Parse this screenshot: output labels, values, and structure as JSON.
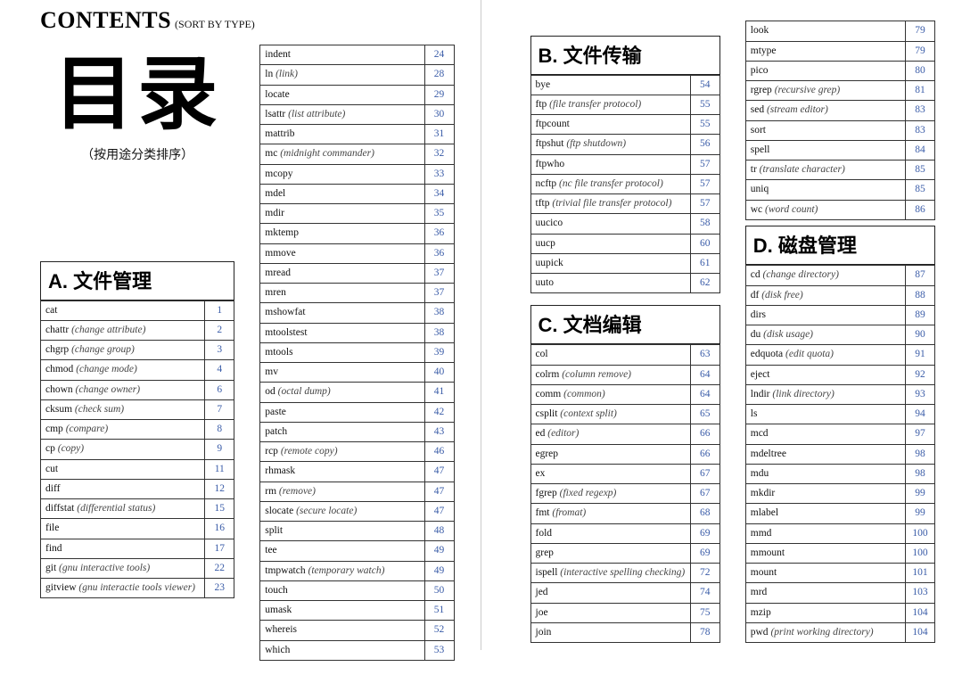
{
  "header": {
    "title": "CONTENTS",
    "sub": "(SORT BY TYPE)",
    "big_cjk": "目录",
    "sub_cjk": "（按用途分类排序）"
  },
  "sections": {
    "A": {
      "label": "A. 文件管理"
    },
    "B": {
      "label": "B. 文件传输"
    },
    "C": {
      "label": "C. 文档编辑"
    },
    "D": {
      "label": "D. 磁盘管理"
    }
  },
  "tables": {
    "A1": [
      {
        "cmd": "cat",
        "note": "",
        "pg": "1"
      },
      {
        "cmd": "chattr",
        "note": "(change attribute)",
        "pg": "2"
      },
      {
        "cmd": "chgrp",
        "note": "(change group)",
        "pg": "3"
      },
      {
        "cmd": "chmod",
        "note": "(change mode)",
        "pg": "4"
      },
      {
        "cmd": "chown",
        "note": "(change owner)",
        "pg": "6"
      },
      {
        "cmd": "cksum",
        "note": "(check sum)",
        "pg": "7"
      },
      {
        "cmd": "cmp",
        "note": "(compare)",
        "pg": "8"
      },
      {
        "cmd": "cp",
        "note": "(copy)",
        "pg": "9"
      },
      {
        "cmd": "cut",
        "note": "",
        "pg": "11"
      },
      {
        "cmd": "diff",
        "note": "",
        "pg": "12"
      },
      {
        "cmd": "diffstat",
        "note": "(differential status)",
        "pg": "15"
      },
      {
        "cmd": "file",
        "note": "",
        "pg": "16"
      },
      {
        "cmd": "find",
        "note": "",
        "pg": "17"
      },
      {
        "cmd": "git",
        "note": "(gnu interactive tools)",
        "pg": "22"
      },
      {
        "cmd": "gitview",
        "note": "(gnu interactie tools viewer)",
        "pg": "23"
      }
    ],
    "A2": [
      {
        "cmd": "indent",
        "note": "",
        "pg": "24"
      },
      {
        "cmd": "ln",
        "note": "(link)",
        "pg": "28"
      },
      {
        "cmd": "locate",
        "note": "",
        "pg": "29"
      },
      {
        "cmd": "lsattr",
        "note": "(list attribute)",
        "pg": "30"
      },
      {
        "cmd": "mattrib",
        "note": "",
        "pg": "31"
      },
      {
        "cmd": "mc",
        "note": "(midnight commander)",
        "pg": "32"
      },
      {
        "cmd": "mcopy",
        "note": "",
        "pg": "33"
      },
      {
        "cmd": "mdel",
        "note": "",
        "pg": "34"
      },
      {
        "cmd": "mdir",
        "note": "",
        "pg": "35"
      },
      {
        "cmd": "mktemp",
        "note": "",
        "pg": "36"
      },
      {
        "cmd": "mmove",
        "note": "",
        "pg": "36"
      },
      {
        "cmd": "mread",
        "note": "",
        "pg": "37"
      },
      {
        "cmd": "mren",
        "note": "",
        "pg": "37"
      },
      {
        "cmd": "mshowfat",
        "note": "",
        "pg": "38"
      },
      {
        "cmd": "mtoolstest",
        "note": "",
        "pg": "38"
      },
      {
        "cmd": "mtools",
        "note": "",
        "pg": "39"
      },
      {
        "cmd": "mv",
        "note": "",
        "pg": "40"
      },
      {
        "cmd": "od",
        "note": "(octal dump)",
        "pg": "41"
      },
      {
        "cmd": "paste",
        "note": "",
        "pg": "42"
      },
      {
        "cmd": "patch",
        "note": "",
        "pg": "43"
      },
      {
        "cmd": "rcp",
        "note": "(remote copy)",
        "pg": "46"
      },
      {
        "cmd": "rhmask",
        "note": "",
        "pg": "47"
      },
      {
        "cmd": "rm",
        "note": "(remove)",
        "pg": "47"
      },
      {
        "cmd": "slocate",
        "note": "(secure locate)",
        "pg": "47"
      },
      {
        "cmd": "split",
        "note": "",
        "pg": "48"
      },
      {
        "cmd": "tee",
        "note": "",
        "pg": "49"
      },
      {
        "cmd": "tmpwatch",
        "note": "(temporary watch)",
        "pg": "49"
      },
      {
        "cmd": "touch",
        "note": "",
        "pg": "50"
      },
      {
        "cmd": "umask",
        "note": "",
        "pg": "51"
      },
      {
        "cmd": "whereis",
        "note": "",
        "pg": "52"
      },
      {
        "cmd": "which",
        "note": "",
        "pg": "53"
      }
    ],
    "B": [
      {
        "cmd": "bye",
        "note": "",
        "pg": "54"
      },
      {
        "cmd": "ftp",
        "note": "(file transfer protocol)",
        "pg": "55"
      },
      {
        "cmd": "ftpcount",
        "note": "",
        "pg": "55"
      },
      {
        "cmd": "ftpshut",
        "note": "(ftp shutdown)",
        "pg": "56"
      },
      {
        "cmd": "ftpwho",
        "note": "",
        "pg": "57"
      },
      {
        "cmd": "ncftp",
        "note": "(nc file transfer protocol)",
        "pg": "57"
      },
      {
        "cmd": "tftp",
        "note": "(trivial file transfer protocol)",
        "pg": "57"
      },
      {
        "cmd": "uucico",
        "note": "",
        "pg": "58"
      },
      {
        "cmd": "uucp",
        "note": "",
        "pg": "60"
      },
      {
        "cmd": "uupick",
        "note": "",
        "pg": "61"
      },
      {
        "cmd": "uuto",
        "note": "",
        "pg": "62"
      }
    ],
    "C": [
      {
        "cmd": "col",
        "note": "",
        "pg": "63"
      },
      {
        "cmd": "colrm",
        "note": "(column remove)",
        "pg": "64"
      },
      {
        "cmd": "comm",
        "note": "(common)",
        "pg": "64"
      },
      {
        "cmd": "csplit",
        "note": "(context split)",
        "pg": "65"
      },
      {
        "cmd": "ed",
        "note": "(editor)",
        "pg": "66"
      },
      {
        "cmd": "egrep",
        "note": "",
        "pg": "66"
      },
      {
        "cmd": "ex",
        "note": "",
        "pg": "67"
      },
      {
        "cmd": "fgrep",
        "note": "(fixed regexp)",
        "pg": "67"
      },
      {
        "cmd": "fmt",
        "note": "(fromat)",
        "pg": "68"
      },
      {
        "cmd": "fold",
        "note": "",
        "pg": "69"
      },
      {
        "cmd": "grep",
        "note": "",
        "pg": "69"
      },
      {
        "cmd": "ispell",
        "note": "(interactive spelling checking)",
        "pg": "72"
      },
      {
        "cmd": "jed",
        "note": "",
        "pg": "74"
      },
      {
        "cmd": "joe",
        "note": "",
        "pg": "75"
      },
      {
        "cmd": "join",
        "note": "",
        "pg": "78"
      }
    ],
    "C2": [
      {
        "cmd": "look",
        "note": "",
        "pg": "79"
      },
      {
        "cmd": "mtype",
        "note": "",
        "pg": "79"
      },
      {
        "cmd": "pico",
        "note": "",
        "pg": "80"
      },
      {
        "cmd": "rgrep",
        "note": "(recursive grep)",
        "pg": "81"
      },
      {
        "cmd": "sed",
        "note": "(stream editor)",
        "pg": "83"
      },
      {
        "cmd": "sort",
        "note": "",
        "pg": "83"
      },
      {
        "cmd": "spell",
        "note": "",
        "pg": "84"
      },
      {
        "cmd": "tr",
        "note": "(translate character)",
        "pg": "85"
      },
      {
        "cmd": "uniq",
        "note": "",
        "pg": "85"
      },
      {
        "cmd": "wc",
        "note": "(word count)",
        "pg": "86"
      }
    ],
    "D": [
      {
        "cmd": "cd",
        "note": "(change directory)",
        "pg": "87"
      },
      {
        "cmd": "df",
        "note": "(disk free)",
        "pg": "88"
      },
      {
        "cmd": "dirs",
        "note": "",
        "pg": "89"
      },
      {
        "cmd": "du",
        "note": "(disk usage)",
        "pg": "90"
      },
      {
        "cmd": "edquota",
        "note": "(edit quota)",
        "pg": "91"
      },
      {
        "cmd": "eject",
        "note": "",
        "pg": "92"
      },
      {
        "cmd": "lndir",
        "note": "(link directory)",
        "pg": "93"
      },
      {
        "cmd": "ls",
        "note": "",
        "pg": "94"
      },
      {
        "cmd": "mcd",
        "note": "",
        "pg": "97"
      },
      {
        "cmd": "mdeltree",
        "note": "",
        "pg": "98"
      },
      {
        "cmd": "mdu",
        "note": "",
        "pg": "98"
      },
      {
        "cmd": "mkdir",
        "note": "",
        "pg": "99"
      },
      {
        "cmd": "mlabel",
        "note": "",
        "pg": "99"
      },
      {
        "cmd": "mmd",
        "note": "",
        "pg": "100"
      },
      {
        "cmd": "mmount",
        "note": "",
        "pg": "100"
      },
      {
        "cmd": "mount",
        "note": "",
        "pg": "101"
      },
      {
        "cmd": "mrd",
        "note": "",
        "pg": "103"
      },
      {
        "cmd": "mzip",
        "note": "",
        "pg": "104"
      },
      {
        "cmd": "pwd",
        "note": "(print working directory)",
        "pg": "104"
      }
    ]
  }
}
